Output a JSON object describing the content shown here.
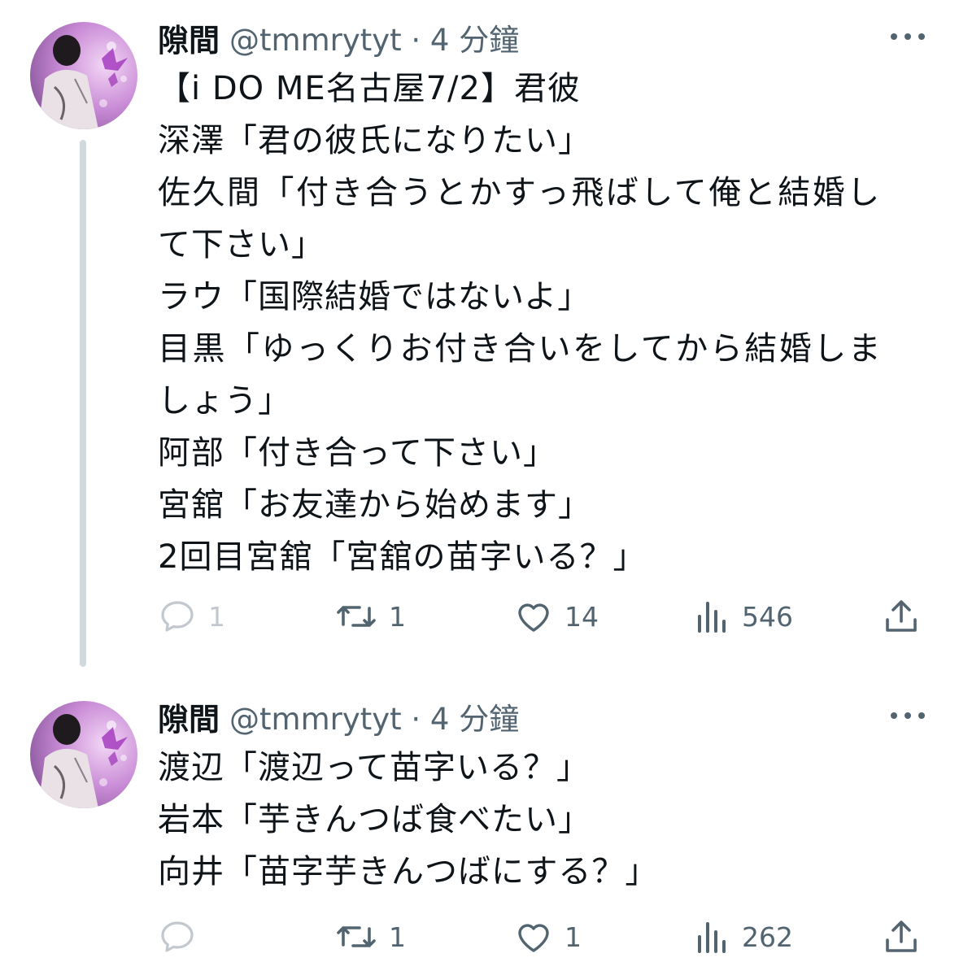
{
  "tweets": [
    {
      "name": "隙間",
      "handle_time": "@tmmrytyt · 4 分鐘",
      "lines": [
        "【i DO ME名古屋7/2】君彼",
        "深澤「君の彼氏になりたい」",
        "佐久間「付き合うとかすっ飛ばして俺と結婚し",
        "て下さい」",
        "ラウ「国際結婚ではないよ」",
        "目黒「ゆっくりお付き合いをしてから結婚しま",
        "しょう」",
        "阿部「付き合って下さい」",
        "宮舘「お友達から始めます」",
        "2回目宮舘「宮舘の苗字いる？」"
      ],
      "stats": {
        "replies": "1",
        "retweets": "1",
        "likes": "14",
        "views": "546"
      }
    },
    {
      "name": "隙間",
      "handle_time": "@tmmrytyt · 4 分鐘",
      "lines": [
        "渡辺「渡辺って苗字いる？」",
        "岩本「芋きんつば食べたい」",
        "向井「苗字芋きんつばにする？」"
      ],
      "stats": {
        "replies": "",
        "retweets": "1",
        "likes": "1",
        "views": "262"
      }
    }
  ],
  "icons": {
    "reply": "reply-icon",
    "retweet": "retweet-icon",
    "like": "heart-icon",
    "views": "views-icon",
    "share": "share-icon",
    "more": "more-icon"
  },
  "colors": {
    "text": "#0f1419",
    "secondary": "#536471",
    "thread_line": "#cfd9de",
    "avatar_accent": "#b15fc8"
  }
}
